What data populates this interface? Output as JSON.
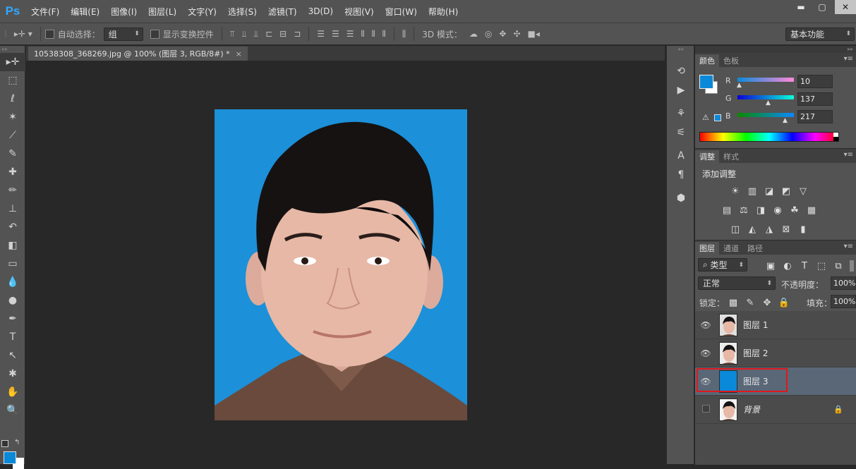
{
  "app": {
    "logo": "Ps"
  },
  "menu": [
    "文件(F)",
    "编辑(E)",
    "图像(I)",
    "图层(L)",
    "文字(Y)",
    "选择(S)",
    "滤镜(T)",
    "3D(D)",
    "视图(V)",
    "窗口(W)",
    "帮助(H)"
  ],
  "window_controls": {
    "min": "▬",
    "max": "▢",
    "close": "✕"
  },
  "options": {
    "auto_select_label": "自动选择：",
    "auto_select_value": "组",
    "show_transform_label": "显示变换控件",
    "mode3d_label": "3D 模式：",
    "workspace": "基本功能"
  },
  "document": {
    "tab_title": "10538308_368269.jpg @ 100% (图层 3, RGB/8#) *",
    "close": "×"
  },
  "color_panel": {
    "tabs": [
      "颜色",
      "色板"
    ],
    "r_label": "R",
    "g_label": "G",
    "b_label": "B",
    "r": "10",
    "g": "137",
    "b": "217",
    "foreground": "#0a89d9"
  },
  "adjust_panel": {
    "tabs": [
      "调整",
      "样式"
    ],
    "title": "添加调整"
  },
  "layers_panel": {
    "tabs": [
      "图层",
      "通道",
      "路径"
    ],
    "filter_label": "类型",
    "blend_mode": "正常",
    "opacity_label": "不透明度：",
    "opacity": "100%",
    "lock_label": "锁定：",
    "fill_label": "填充：",
    "fill": "100%",
    "layers": [
      {
        "name": "图层 1",
        "visible": true,
        "selected": false
      },
      {
        "name": "图层 2",
        "visible": true,
        "selected": false
      },
      {
        "name": "图层 3",
        "visible": true,
        "selected": true
      },
      {
        "name": "背景",
        "visible": false,
        "selected": false,
        "locked": true
      }
    ]
  },
  "colors": {
    "accent": "#0a89d9",
    "highlight_box": "#e0181c",
    "photo_bg": "#1c90d8"
  }
}
